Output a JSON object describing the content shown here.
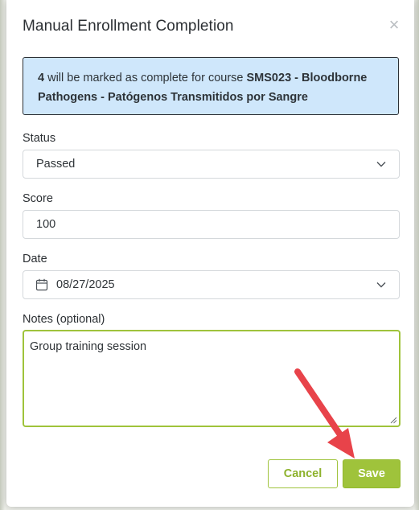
{
  "dialog": {
    "title": "Manual Enrollment Completion",
    "close_glyph": "×"
  },
  "info": {
    "count": "4",
    "text_middle": " will be marked as complete for course ",
    "course": "SMS023 - Bloodborne Pathogens - Patógenos Transmitidos por Sangre"
  },
  "status": {
    "label": "Status",
    "value": "Passed"
  },
  "score": {
    "label": "Score",
    "value": "100"
  },
  "date": {
    "label": "Date",
    "value": "08/27/2025"
  },
  "notes": {
    "label": "Notes (optional)",
    "value": "Group training session"
  },
  "buttons": {
    "cancel": "Cancel",
    "save": "Save"
  },
  "colors": {
    "accent_green": "#9fc33b",
    "info_bg": "#cfe7fb",
    "annotation_arrow": "#e8434a"
  },
  "icons": {
    "close": "close-icon",
    "dropdown": "chevron-down-icon",
    "calendar": "calendar-icon",
    "resize": "resize-grip-icon"
  }
}
